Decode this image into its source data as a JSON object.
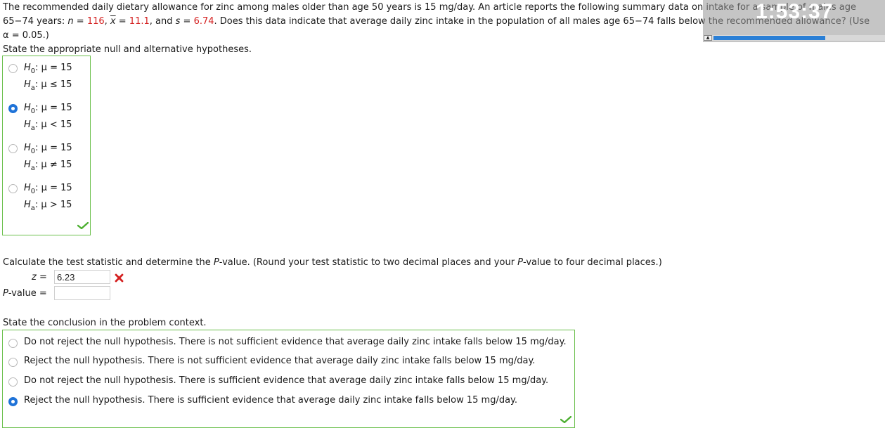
{
  "question": {
    "line1": "The recommended daily dietary allowance for zinc among males older than age 50 years is 15 mg/day. An article reports the following summary data on intake for a sample of males age",
    "line2_a": "65−74 years: ",
    "n_label": "n",
    "eq": " = ",
    "n_value": "116",
    "comma1": ", ",
    "xbar_label": "x",
    "xbar_value": "11.1",
    "and_s": ", and ",
    "s_label": "s",
    "s_value": "6.74",
    "line2_b": ". Does this data indicate that average daily zinc intake in the population of all males age 65−74 falls below the recommended allowance? (Use",
    "line3": "α = 0.05.)"
  },
  "part1": {
    "prompt": "State the appropriate null and alternative hypotheses.",
    "options": [
      {
        "h0": "H",
        "h0_sub": "0",
        "h0_rest": ": μ = 15",
        "ha": "H",
        "ha_sub": "a",
        "ha_rest": ": μ ≤ 15",
        "selected": false
      },
      {
        "h0": "H",
        "h0_sub": "0",
        "h0_rest": ": μ = 15",
        "ha": "H",
        "ha_sub": "a",
        "ha_rest": ": μ < 15",
        "selected": true
      },
      {
        "h0": "H",
        "h0_sub": "0",
        "h0_rest": ": μ = 15",
        "ha": "H",
        "ha_sub": "a",
        "ha_rest": ": μ ≠ 15",
        "selected": false
      },
      {
        "h0": "H",
        "h0_sub": "0",
        "h0_rest": ": μ = 15",
        "ha": "H",
        "ha_sub": "a",
        "ha_rest": ": μ > 15",
        "selected": false
      }
    ]
  },
  "part2": {
    "prompt_a": "Calculate the test statistic and determine the ",
    "prompt_p": "P",
    "prompt_b": "-value. (Round your test statistic to two decimal places and your ",
    "prompt_p2": "P",
    "prompt_c": "-value to four decimal places.)",
    "z_label": "z",
    "z_eq": " = ",
    "z_value": "6.23",
    "p_label": "P",
    "p_rest": "-value = ",
    "p_value": ""
  },
  "part3": {
    "prompt": "State the conclusion in the problem context.",
    "options": [
      {
        "text": "Do not reject the null hypothesis. There is not sufficient evidence that average daily zinc intake falls below 15 mg/day.",
        "selected": false
      },
      {
        "text": "Reject the null hypothesis. There is not sufficient evidence that average daily zinc intake falls below 15 mg/day.",
        "selected": false
      },
      {
        "text": "Do not reject the null hypothesis. There is sufficient evidence that average daily zinc intake falls below 15 mg/day.",
        "selected": false
      },
      {
        "text": "Reject the null hypothesis. There is sufficient evidence that average daily zinc intake falls below 15 mg/day.",
        "selected": true
      }
    ]
  },
  "timer": {
    "time": "1:53:37",
    "progress_fraction": 0.65
  },
  "colors": {
    "accent": "#1f73d8",
    "correct_border": "#6abf4b",
    "wrong": "#d42020",
    "highlight_value": "#d42020"
  },
  "icons": {
    "correct": "check-mark-icon",
    "incorrect": "x-mark-icon"
  }
}
